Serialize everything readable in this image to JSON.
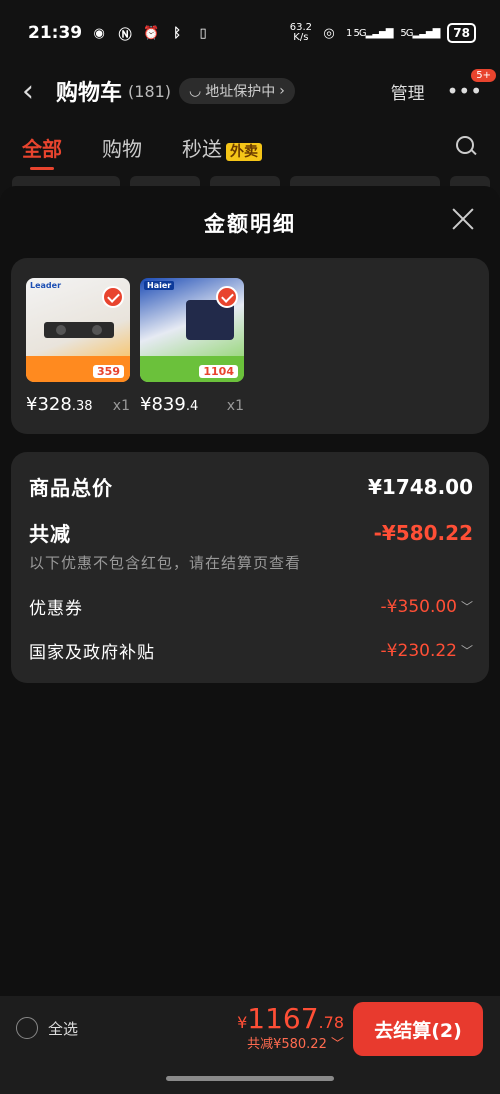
{
  "status": {
    "time": "21:39",
    "net_speed": "63.2",
    "net_unit": "K/s",
    "sim1": "1 5G",
    "sim2": "5G",
    "battery": "78"
  },
  "nav": {
    "title": "购物车",
    "count": "(181)",
    "addr_label": "地址保护中",
    "manage": "管理",
    "badge": "5+"
  },
  "tabs": [
    {
      "label": "全部"
    },
    {
      "label": "购物"
    },
    {
      "label": "秒送"
    }
  ],
  "waimai": "外卖",
  "sheet": {
    "title": "金额明细",
    "products": [
      {
        "brand": "Leader",
        "promo_price": "359",
        "price_int": "¥328",
        "price_dec": ".38",
        "qty": "x1"
      },
      {
        "brand": "Haier",
        "promo_price": "1104",
        "price_int": "¥839",
        "price_dec": ".4",
        "qty": "x1"
      }
    ],
    "total_label": "商品总价",
    "total_value": "¥1748.00",
    "discount_label": "共减",
    "discount_value": "-¥580.22",
    "note": "以下优惠不包含红包，请在结算页查看",
    "coupon_label": "优惠券",
    "coupon_value": "-¥350.00",
    "subsidy_label": "国家及政府补贴",
    "subsidy_value": "-¥230.22"
  },
  "bottom": {
    "select_all": "全选",
    "currency": "¥",
    "total_int": "1167",
    "total_dec": ".78",
    "saved": "共减¥580.22",
    "checkout": "去结算(2)"
  }
}
